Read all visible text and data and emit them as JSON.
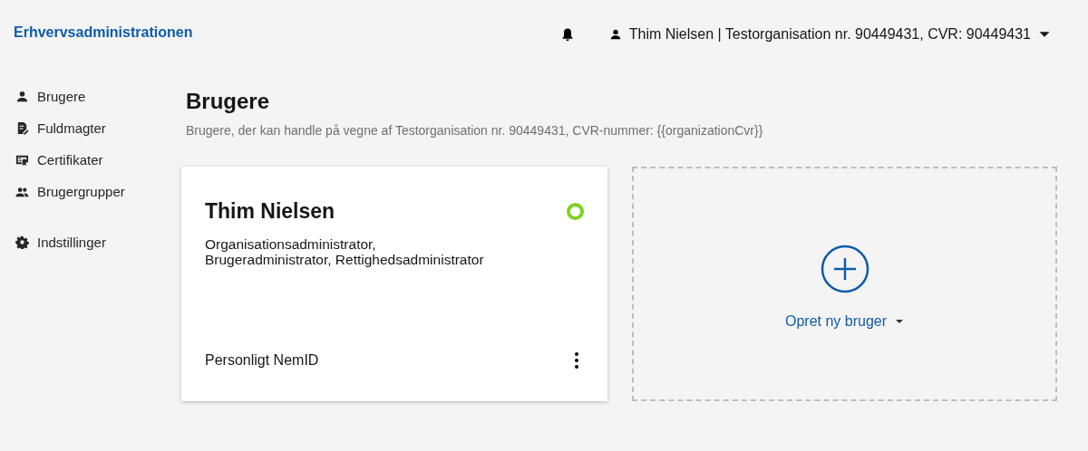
{
  "header": {
    "brand": "Erhvervsadministrationen",
    "user_menu": "Thim Nielsen | Testorganisation nr. 90449431, CVR: 90449431"
  },
  "sidebar": {
    "groups": [
      {
        "items": [
          {
            "label": "Brugere"
          },
          {
            "label": "Fuldmagter"
          },
          {
            "label": "Certifikater"
          },
          {
            "label": "Brugergrupper"
          }
        ]
      },
      {
        "items": [
          {
            "label": "Indstillinger"
          }
        ]
      }
    ]
  },
  "page": {
    "title": "Brugere",
    "subtitle": "Brugere, der kan handle på vegne af Testorganisation nr. 90449431, CVR-nummer: {{organizationCvr}}"
  },
  "cards": [
    {
      "kind": "user",
      "name": "Thim Nielsen",
      "active": true,
      "roles": [
        "Organisationsadministrator,",
        "Brugeradministrator, Rettighedsadministrator"
      ],
      "login_type": "Personligt NemID"
    },
    {
      "kind": "add",
      "label": "Opret ny bruger"
    }
  ]
}
